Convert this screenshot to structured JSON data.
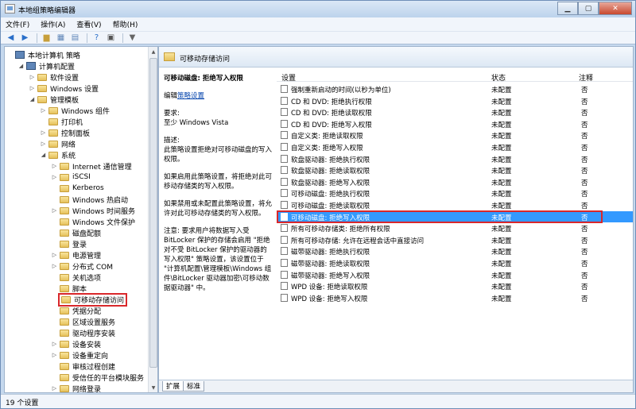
{
  "window": {
    "title": "本地组策略编辑器"
  },
  "menu": [
    "文件(F)",
    "操作(A)",
    "查看(V)",
    "帮助(H)"
  ],
  "tree": [
    {
      "label": "本地计算机 策略",
      "level": 0,
      "toggle": "",
      "icon": "pc"
    },
    {
      "label": "计算机配置",
      "level": 1,
      "toggle": "◢",
      "icon": "pc"
    },
    {
      "label": "软件设置",
      "level": 2,
      "toggle": "▷",
      "icon": "folder"
    },
    {
      "label": "Windows 设置",
      "level": 2,
      "toggle": "▷",
      "icon": "folder"
    },
    {
      "label": "管理模板",
      "level": 2,
      "toggle": "◢",
      "icon": "folder"
    },
    {
      "label": "Windows 组件",
      "level": 3,
      "toggle": "▷",
      "icon": "folder"
    },
    {
      "label": "打印机",
      "level": 3,
      "toggle": "",
      "icon": "folder"
    },
    {
      "label": "控制面板",
      "level": 3,
      "toggle": "▷",
      "icon": "folder"
    },
    {
      "label": "网络",
      "level": 3,
      "toggle": "▷",
      "icon": "folder"
    },
    {
      "label": "系统",
      "level": 3,
      "toggle": "◢",
      "icon": "folder"
    },
    {
      "label": "Internet 通信管理",
      "level": 4,
      "toggle": "▷",
      "icon": "folder"
    },
    {
      "label": "iSCSI",
      "level": 4,
      "toggle": "▷",
      "icon": "folder"
    },
    {
      "label": "Kerberos",
      "level": 4,
      "toggle": "",
      "icon": "folder"
    },
    {
      "label": "Windows 热启动",
      "level": 4,
      "toggle": "",
      "icon": "folder"
    },
    {
      "label": "Windows 时间服务",
      "level": 4,
      "toggle": "▷",
      "icon": "folder"
    },
    {
      "label": "Windows 文件保护",
      "level": 4,
      "toggle": "",
      "icon": "folder"
    },
    {
      "label": "磁盘配额",
      "level": 4,
      "toggle": "",
      "icon": "folder"
    },
    {
      "label": "登录",
      "level": 4,
      "toggle": "",
      "icon": "folder"
    },
    {
      "label": "电源管理",
      "level": 4,
      "toggle": "▷",
      "icon": "folder"
    },
    {
      "label": "分布式 COM",
      "level": 4,
      "toggle": "▷",
      "icon": "folder"
    },
    {
      "label": "关机选项",
      "level": 4,
      "toggle": "",
      "icon": "folder"
    },
    {
      "label": "脚本",
      "level": 4,
      "toggle": "",
      "icon": "folder"
    },
    {
      "label": "可移动存储访问",
      "level": 4,
      "toggle": "",
      "icon": "folder",
      "highlighted": true
    },
    {
      "label": "凭据分配",
      "level": 4,
      "toggle": "",
      "icon": "folder"
    },
    {
      "label": "区域设置服务",
      "level": 4,
      "toggle": "",
      "icon": "folder"
    },
    {
      "label": "驱动程序安装",
      "level": 4,
      "toggle": "",
      "icon": "folder"
    },
    {
      "label": "设备安装",
      "level": 4,
      "toggle": "▷",
      "icon": "folder"
    },
    {
      "label": "设备重定向",
      "level": 4,
      "toggle": "▷",
      "icon": "folder"
    },
    {
      "label": "审核过程创建",
      "level": 4,
      "toggle": "",
      "icon": "folder"
    },
    {
      "label": "受信任的平台模块服务",
      "level": 4,
      "toggle": "",
      "icon": "folder"
    },
    {
      "label": "网络登录",
      "level": 4,
      "toggle": "▷",
      "icon": "folder"
    }
  ],
  "right": {
    "header_title": "可移动存储访问",
    "desc": {
      "title": "可移动磁盘: 拒绝写入权限",
      "edit_prefix": "编辑",
      "edit_link": "策略设置",
      "req_label": "要求:",
      "req_value": "至少 Windows Vista",
      "desc_label": "描述:",
      "p1": "此策略设置拒绝对可移动磁盘的写入权限。",
      "p2": "如果启用此策略设置，将拒绝对此可移动存储类的写入权限。",
      "p3": "如果禁用或未配置此策略设置，将允许对此可移动存储类的写入权限。",
      "p4": "注意: 要求用户将数据写入受 BitLocker 保护的存储会启用 \"拒绝对不受 BitLocker 保护的驱动器的写入权限\" 策略设置，该设置位于 \"计算机配置\\管理模板\\Windows 组件\\BitLocker 驱动器加密\\可移动数据驱动器\" 中。"
    },
    "columns": {
      "setting": "设置",
      "state": "状态",
      "note": "注释"
    },
    "rows": [
      {
        "setting": "强制重新启动的时间(以秒为单位)",
        "state": "未配置",
        "note": "否"
      },
      {
        "setting": "CD 和 DVD: 拒绝执行权限",
        "state": "未配置",
        "note": "否"
      },
      {
        "setting": "CD 和 DVD: 拒绝读取权限",
        "state": "未配置",
        "note": "否"
      },
      {
        "setting": "CD 和 DVD: 拒绝写入权限",
        "state": "未配置",
        "note": "否"
      },
      {
        "setting": "自定义类: 拒绝读取权限",
        "state": "未配置",
        "note": "否"
      },
      {
        "setting": "自定义类: 拒绝写入权限",
        "state": "未配置",
        "note": "否"
      },
      {
        "setting": "软盘驱动器: 拒绝执行权限",
        "state": "未配置",
        "note": "否"
      },
      {
        "setting": "软盘驱动器: 拒绝读取权限",
        "state": "未配置",
        "note": "否"
      },
      {
        "setting": "软盘驱动器: 拒绝写入权限",
        "state": "未配置",
        "note": "否"
      },
      {
        "setting": "可移动磁盘: 拒绝执行权限",
        "state": "未配置",
        "note": "否"
      },
      {
        "setting": "可移动磁盘: 拒绝读取权限",
        "state": "未配置",
        "note": "否"
      },
      {
        "setting": "可移动磁盘: 拒绝写入权限",
        "state": "未配置",
        "note": "否",
        "selected": true
      },
      {
        "setting": "所有可移动存储类: 拒绝所有权限",
        "state": "未配置",
        "note": "否"
      },
      {
        "setting": "所有可移动存储: 允许在远程会话中直接访问",
        "state": "未配置",
        "note": "否"
      },
      {
        "setting": "磁带驱动器: 拒绝执行权限",
        "state": "未配置",
        "note": "否"
      },
      {
        "setting": "磁带驱动器: 拒绝读取权限",
        "state": "未配置",
        "note": "否"
      },
      {
        "setting": "磁带驱动器: 拒绝写入权限",
        "state": "未配置",
        "note": "否"
      },
      {
        "setting": "WPD 设备: 拒绝读取权限",
        "state": "未配置",
        "note": "否"
      },
      {
        "setting": "WPD 设备: 拒绝写入权限",
        "state": "未配置",
        "note": "否"
      }
    ],
    "tabs": [
      "扩展",
      "标准"
    ]
  },
  "status": "19 个设置"
}
